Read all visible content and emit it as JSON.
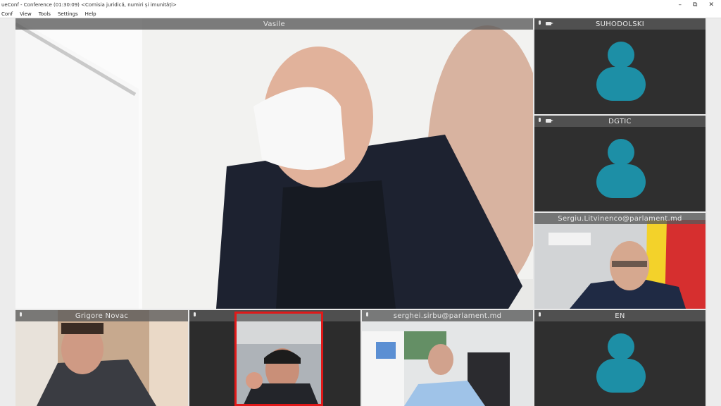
{
  "window": {
    "title": "ueConf - Conference (01:30:09) <Comisia juridică, numiri și imunități>",
    "controls": [
      "–",
      "⧉",
      "✕"
    ]
  },
  "menu": [
    "Conf",
    "View",
    "Tools",
    "Settings",
    "Help"
  ],
  "tiles": {
    "main": {
      "name": "Vasile"
    },
    "t1": {
      "name": "SUHODOLSKI"
    },
    "t2": {
      "name": "DGTIC"
    },
    "t3": {
      "name": "Sergiu.Litvinenco@parlament.md"
    },
    "t4": {
      "name": "EN"
    },
    "b1": {
      "name": "Grigore Novac"
    },
    "b2": {
      "name": ""
    },
    "b3": {
      "name": "serghei.sirbu@parlament.md"
    }
  },
  "colors": {
    "avatar": "#1d8fa6",
    "active_speaker_border": "#e01919",
    "tile_bg": "#2f2f2f"
  },
  "icons": {
    "mic": "mic-icon",
    "camera": "camera-icon",
    "avatar": "user-avatar-icon"
  }
}
